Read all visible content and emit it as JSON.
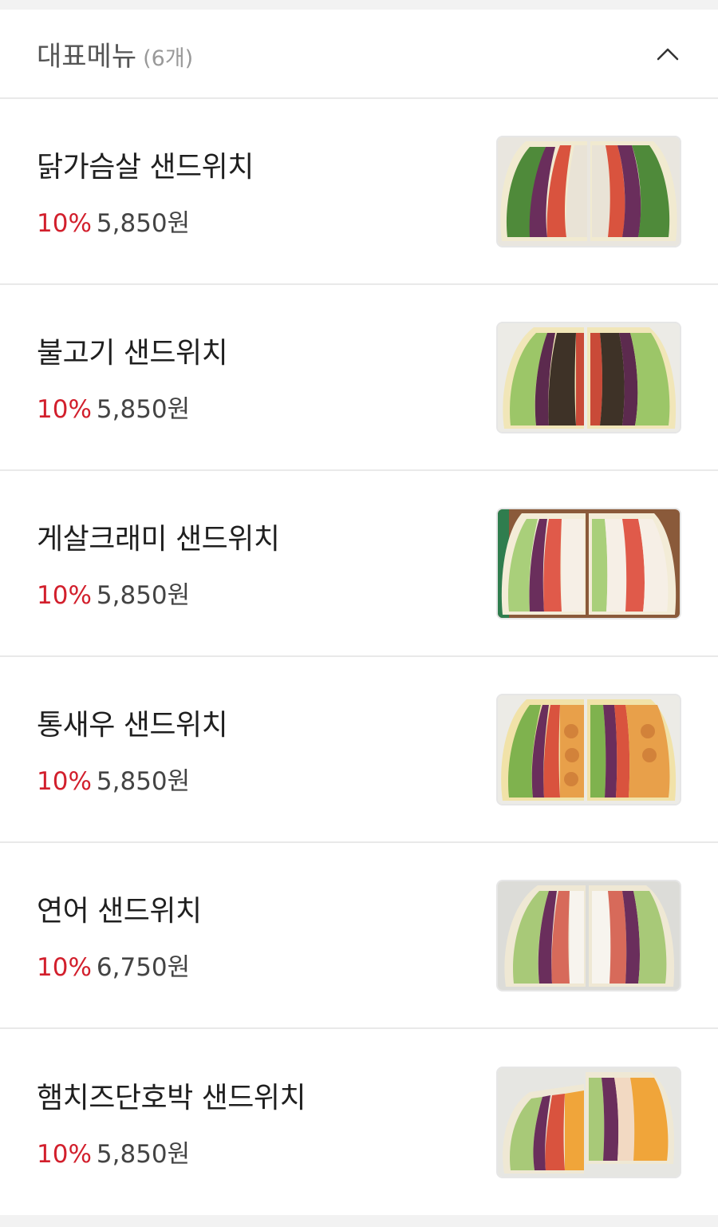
{
  "section": {
    "title": "대표메뉴",
    "count": "(6개)"
  },
  "items": [
    {
      "name": "닭가슴살 샌드위치",
      "discount": "10%",
      "price": "5,850원",
      "image_icon": "chicken-breast-sandwich-image"
    },
    {
      "name": "불고기 샌드위치",
      "discount": "10%",
      "price": "5,850원",
      "image_icon": "bulgogi-sandwich-image"
    },
    {
      "name": "게살크래미 샌드위치",
      "discount": "10%",
      "price": "5,850원",
      "image_icon": "crab-stick-sandwich-image"
    },
    {
      "name": "통새우 샌드위치",
      "discount": "10%",
      "price": "5,850원",
      "image_icon": "whole-shrimp-sandwich-image"
    },
    {
      "name": "연어 샌드위치",
      "discount": "10%",
      "price": "6,750원",
      "image_icon": "salmon-sandwich-image"
    },
    {
      "name": "햄치즈단호박 샌드위치",
      "discount": "10%",
      "price": "5,850원",
      "image_icon": "ham-cheese-pumpkin-sandwich-image"
    }
  ],
  "colors": {
    "discount": "#d21f2c",
    "divider": "#e9e9e9",
    "background": "#f2f2f2"
  }
}
